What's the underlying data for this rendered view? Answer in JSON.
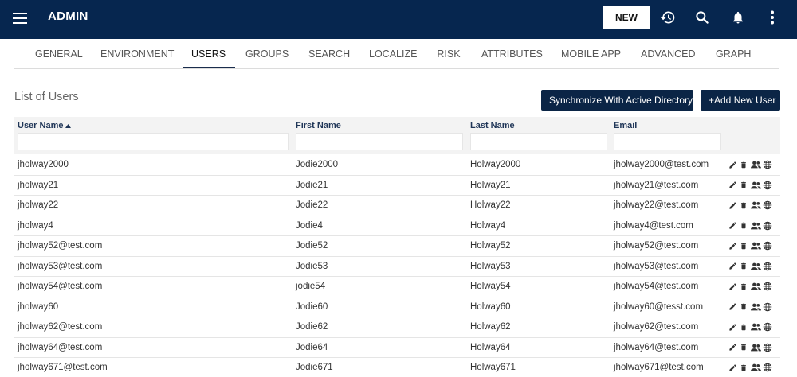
{
  "header": {
    "title": "ADMIN",
    "new_label": "NEW",
    "icons": [
      "menu-icon",
      "history-icon",
      "search-icon",
      "notifications-icon",
      "more-vertical-icon"
    ]
  },
  "tabs": [
    {
      "label": "GENERAL",
      "active": false
    },
    {
      "label": "ENVIRONMENT",
      "active": false
    },
    {
      "label": "USERS",
      "active": true
    },
    {
      "label": "GROUPS",
      "active": false
    },
    {
      "label": "SEARCH",
      "active": false
    },
    {
      "label": "LOCALIZE",
      "active": false
    },
    {
      "label": "RISK",
      "active": false
    },
    {
      "label": "ATTRIBUTES",
      "active": false
    },
    {
      "label": "MOBILE APP",
      "active": false
    },
    {
      "label": "ADVANCED",
      "active": false
    },
    {
      "label": "GRAPH",
      "active": false
    }
  ],
  "section": {
    "title": "List of Users",
    "sync_label": "Synchronize With Active Directory",
    "add_label": "+Add New User"
  },
  "table": {
    "columns": [
      "User Name",
      "First Name",
      "Last Name",
      "Email"
    ],
    "sorted_column": "User Name",
    "sort_direction": "ascending",
    "filters": [
      "",
      "",
      "",
      ""
    ],
    "row_action_icons": [
      "edit-icon",
      "delete-icon",
      "group-icon",
      "globe-icon"
    ],
    "rows": [
      [
        "jholway2000",
        "Jodie2000",
        "Holway2000",
        "jholway2000@test.com"
      ],
      [
        "jholway21",
        "Jodie21",
        "Holway21",
        "jholway21@test.com"
      ],
      [
        "jholway22",
        "Jodie22",
        "Holway22",
        "jholway22@test.com"
      ],
      [
        "jholway4",
        "Jodie4",
        "Holway4",
        "jholway4@test.com"
      ],
      [
        "jholway52@test.com",
        "Jodie52",
        "Holway52",
        "jholway52@test.com"
      ],
      [
        "jholway53@test.com",
        "Jodie53",
        "Holway53",
        "jholway53@test.com"
      ],
      [
        "jholway54@test.com",
        "jodie54",
        "Holway54",
        "jholway54@test.com"
      ],
      [
        "jholway60",
        "Jodie60",
        "Holway60",
        "jholway60@tesst.com"
      ],
      [
        "jholway62@test.com",
        "Jodie62",
        "Holway62",
        "jholway62@test.com"
      ],
      [
        "jholway64@test.com",
        "Jodie64",
        "Holway64",
        "jholway64@test.com"
      ],
      [
        "jholway671@test.com",
        "Jodie671",
        "Holway671",
        "jholway671@test.com"
      ]
    ]
  },
  "colors": {
    "header_bg": "#06264f",
    "primary_button": "#0b2546",
    "table_header_bg": "#f3f3f3",
    "column_label": "#1f3557"
  }
}
